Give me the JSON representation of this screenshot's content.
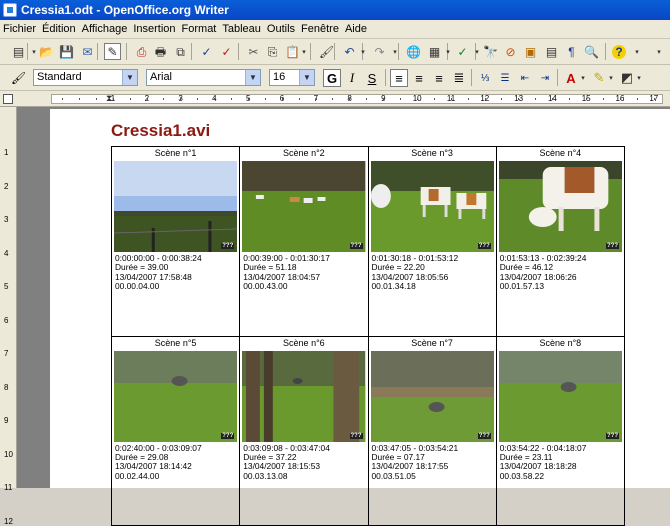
{
  "window": {
    "title": "Cressia1.odt - OpenOffice.org Writer"
  },
  "menu": [
    "Fichier",
    "Édition",
    "Affichage",
    "Insertion",
    "Format",
    "Tableau",
    "Outils",
    "Fenêtre",
    "Aide"
  ],
  "formatting": {
    "style": "Standard",
    "font": "Arial",
    "size": "16",
    "bold": "G",
    "italic": "I",
    "underline": "S"
  },
  "ruler_labels": [
    "1",
    "2",
    "3",
    "4",
    "5",
    "6",
    "7",
    "8",
    "9",
    "10",
    "11",
    "12",
    "13",
    "14",
    "15",
    "16",
    "17",
    "18"
  ],
  "vruler_labels": [
    "1",
    "2",
    "3",
    "4",
    "5",
    "6",
    "7",
    "8",
    "9",
    "10",
    "11",
    "12"
  ],
  "document": {
    "title": "Cressia1.avi",
    "badge": "???",
    "scenes": [
      {
        "label": "Scène n°1",
        "timecode": "0:00:00:00 - 0:00:38:24",
        "duree": "Durée = 39.00",
        "date": "13/04/2007 17:58:48",
        "offset": "00.00.04.00",
        "scene_type": "sky"
      },
      {
        "label": "Scène n°2",
        "timecode": "0:00:39:00 - 0:01:30:17",
        "duree": "Durée = 51.18",
        "date": "13/04/2007 18:04:57",
        "offset": "00.00.43.00",
        "scene_type": "far-cows"
      },
      {
        "label": "Scène n°3",
        "timecode": "0:01:30:18 - 0:01:53:12",
        "duree": "Durée = 22.20",
        "date": "13/04/2007 18:05:56",
        "offset": "00.01.34.18",
        "scene_type": "cows"
      },
      {
        "label": "Scène n°4",
        "timecode": "0:01:53:13 - 0:02:39:24",
        "duree": "Durée = 46.12",
        "date": "13/04/2007 18:06:26",
        "offset": "00.01.57.13",
        "scene_type": "cow-close"
      },
      {
        "label": "Scène n°5",
        "timecode": "0:02:40:00 - 0:03:09:07",
        "duree": "Durée = 29.08",
        "date": "13/04/2007 18:14:42",
        "offset": "00.02.44.00",
        "scene_type": "sheep-field"
      },
      {
        "label": "Scène n°6",
        "timecode": "0:03:09:08 - 0:03:47:04",
        "duree": "Durée = 37.22",
        "date": "13/04/2007 18:15:53",
        "offset": "00.03.13.08",
        "scene_type": "trees"
      },
      {
        "label": "Scène n°7",
        "timecode": "0:03:47:05 - 0:03:54:21",
        "duree": "Durée = 07.17",
        "date": "13/04/2007 18:17:55",
        "offset": "00.03.51.05",
        "scene_type": "sheep-wall"
      },
      {
        "label": "Scène n°8",
        "timecode": "0:03:54:22 - 0:04:18:07",
        "duree": "Durée = 23.11",
        "date": "13/04/2007 18:18:28",
        "offset": "00.03.58.22",
        "scene_type": "sheep-field2"
      }
    ]
  },
  "toolbar1_icons": [
    "new-icon",
    "open-icon",
    "save-icon",
    "email-icon",
    "edit-mode-icon",
    "pdf-icon",
    "print-icon",
    "page-preview-icon",
    "spellcheck-icon",
    "autospell-icon",
    "cut-icon",
    "copy-icon",
    "paste-icon",
    "clone-format-icon",
    "undo-icon",
    "redo-icon",
    "hyperlink-icon",
    "table-icon",
    "show-draw-icon",
    "find-icon",
    "navigator-icon",
    "gallery-icon",
    "datasources-icon",
    "nonprinting-icon",
    "zoom-icon",
    "help-icon"
  ],
  "toolbar2_icons": [
    "styles-icon",
    "align-left-icon",
    "align-center-icon",
    "align-right-icon",
    "justify-icon",
    "numbering-icon",
    "bullets-icon",
    "decrease-indent-icon",
    "increase-indent-icon",
    "font-color-icon",
    "highlight-icon",
    "background-color-icon"
  ]
}
